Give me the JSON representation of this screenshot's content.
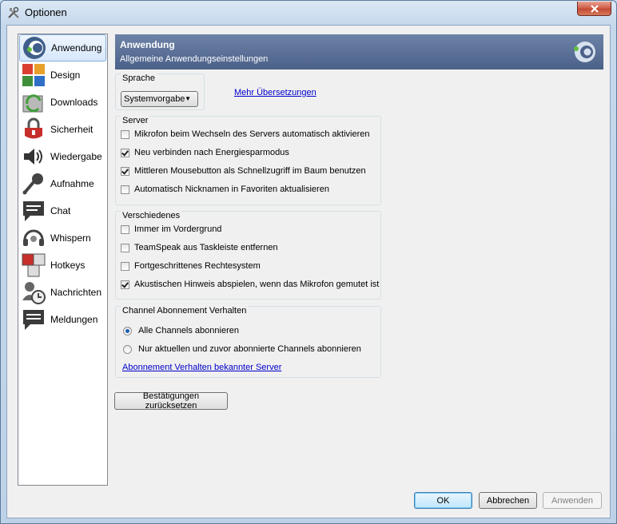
{
  "window": {
    "title": "Optionen"
  },
  "sidebar": {
    "items": [
      {
        "label": "Anwendung",
        "icon": "teamspeak-icon"
      },
      {
        "label": "Design",
        "icon": "design-icon"
      },
      {
        "label": "Downloads",
        "icon": "downloads-icon"
      },
      {
        "label": "Sicherheit",
        "icon": "lock-icon"
      },
      {
        "label": "Wiedergabe",
        "icon": "speaker-icon"
      },
      {
        "label": "Aufnahme",
        "icon": "microphone-icon"
      },
      {
        "label": "Chat",
        "icon": "chat-icon"
      },
      {
        "label": "Whispern",
        "icon": "headset-icon"
      },
      {
        "label": "Hotkeys",
        "icon": "hotkeys-icon"
      },
      {
        "label": "Nachrichten",
        "icon": "messages-icon"
      },
      {
        "label": "Meldungen",
        "icon": "notifications-icon"
      }
    ]
  },
  "header": {
    "title": "Anwendung",
    "subtitle": "Allgemeine Anwendungseinstellungen"
  },
  "language": {
    "group_title": "Sprache",
    "selected": "Systemvorgabe",
    "more_link": "Mehr Übersetzungen"
  },
  "server": {
    "group_title": "Server",
    "options": [
      {
        "label": "Mikrofon beim Wechseln des Servers automatisch aktivieren",
        "checked": false
      },
      {
        "label": "Neu verbinden nach Energiesparmodus",
        "checked": true
      },
      {
        "label": "Mittleren Mousebutton als Schnellzugriff im Baum benutzen",
        "checked": true
      },
      {
        "label": "Automatisch Nicknamen in Favoriten aktualisieren",
        "checked": false
      }
    ]
  },
  "misc": {
    "group_title": "Verschiedenes",
    "options": [
      {
        "label": "Immer im Vordergrund",
        "checked": false
      },
      {
        "label": "TeamSpeak aus Taskleiste entfernen",
        "checked": false
      },
      {
        "label": "Fortgeschrittenes Rechtesystem",
        "checked": false
      },
      {
        "label": "Akustischen Hinweis abspielen, wenn das Mikrofon gemutet ist",
        "checked": true
      }
    ]
  },
  "subscription": {
    "group_title": "Channel Abonnement Verhalten",
    "options": [
      {
        "label": "Alle Channels abonnieren",
        "checked": true
      },
      {
        "label": "Nur aktuellen und zuvor abonnierte Channels abonnieren",
        "checked": false
      }
    ],
    "link": "Abonnement Verhalten bekannter Server"
  },
  "buttons": {
    "reset": "Bestätigungen zurücksetzen",
    "ok": "OK",
    "cancel": "Abbrechen",
    "apply": "Anwenden"
  }
}
